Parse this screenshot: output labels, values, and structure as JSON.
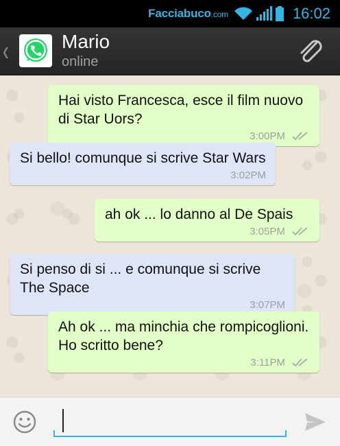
{
  "status_bar": {
    "watermark_main": "Facciabuco",
    "watermark_suffix": ".com",
    "time": "16:02",
    "icons": [
      "wifi-icon",
      "signal-icon",
      "battery-icon"
    ]
  },
  "header": {
    "contact_name": "Mario",
    "contact_status": "online",
    "avatar_icon": "whatsapp-icon",
    "attach_icon": "paperclip-icon",
    "back_icon": "chevron-left-icon"
  },
  "messages": [
    {
      "direction": "out",
      "text": "Hai visto Francesca, esce il film nuovo di Star Uors?",
      "time": "3:00PM",
      "read": true
    },
    {
      "direction": "in",
      "text": "Si bello! comunque si scrive Star Wars",
      "time": "3:02PM"
    },
    {
      "direction": "out",
      "text": "ah ok ... lo danno al De Spais",
      "time": "3:05PM",
      "read": true
    },
    {
      "direction": "in",
      "text": "Si penso di si ... e comunque si scrive The Space",
      "time": "3:07PM"
    },
    {
      "direction": "out",
      "text": "Ah ok ... ma minchia che rompicoglioni. Ho scritto bene?",
      "time": "3:11PM",
      "read": true
    }
  ],
  "input_bar": {
    "value": "",
    "emoji_icon": "smiley-icon",
    "send_icon": "send-icon"
  },
  "colors": {
    "accent": "#33b5e5",
    "outgoing_bubble": "#e1ffc7",
    "incoming_bubble": "#dde5f6",
    "header_bg": "#2c2c2c",
    "whatsapp_green": "#25d366"
  }
}
